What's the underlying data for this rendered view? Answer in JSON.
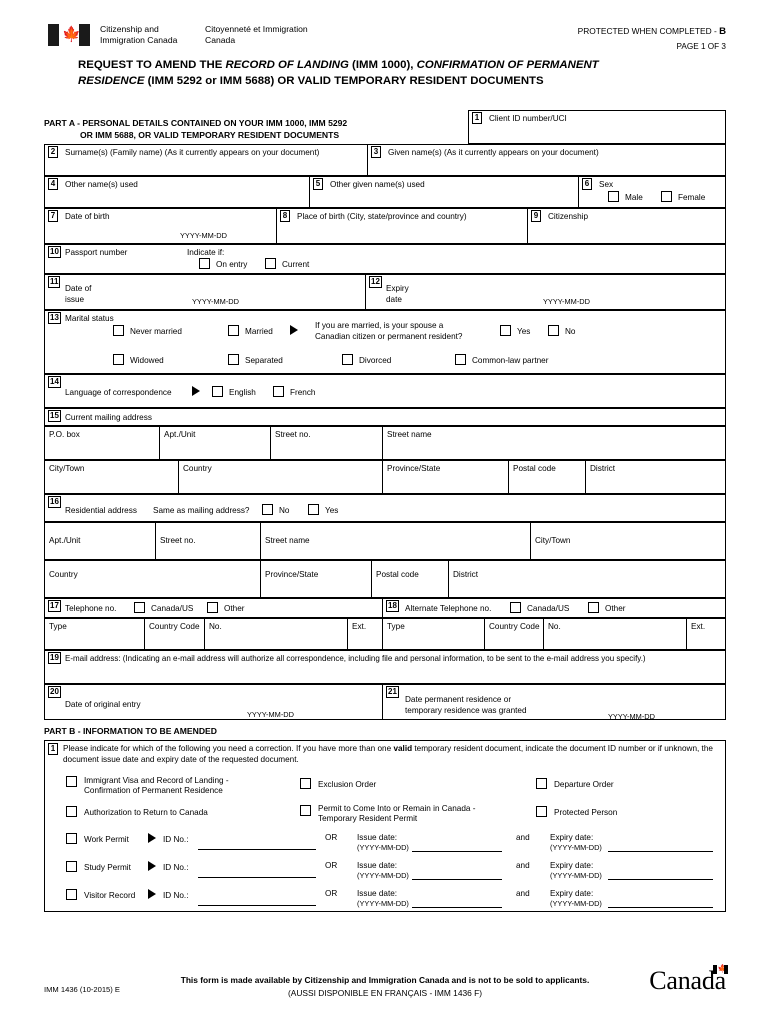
{
  "header": {
    "department_en": "Citizenship and Immigration Canada",
    "department_fr": "Citoyenneté et Immigration Canada",
    "protected": "PROTECTED WHEN COMPLETED - ",
    "protected_level": "B",
    "page_of": "PAGE 1 OF 3",
    "title_line1_a": "REQUEST TO AMEND THE ",
    "title_line1_i1": "RECORD OF LANDING",
    "title_line1_b": " (IMM 1000), ",
    "title_line1_i2": "CONFIRMATION OF PERMANENT",
    "title_line2_i": "RESIDENCE",
    "title_line2_b": " (IMM 5292 or IMM 5688) OR VALID TEMPORARY RESIDENT DOCUMENTS"
  },
  "part_a": {
    "heading_line1": "PART A - PERSONAL DETAILS CONTAINED ON YOUR IMM 1000, IMM 5292",
    "heading_line2": "OR IMM 5688, OR VALID TEMPORARY RESIDENT DOCUMENTS",
    "f1": {
      "num": "1",
      "label": "Client ID number/UCI"
    },
    "f2": {
      "num": "2",
      "label": "Surname(s) (Family name) (As it currently appears on your document)"
    },
    "f3": {
      "num": "3",
      "label": "Given name(s) (As it currently appears on your document)"
    },
    "f4": {
      "num": "4",
      "label": "Other name(s) used"
    },
    "f5": {
      "num": "5",
      "label": "Other given name(s) used"
    },
    "f6": {
      "num": "6",
      "label": "Sex",
      "male": "Male",
      "female": "Female"
    },
    "f7": {
      "num": "7",
      "label": "Date of birth",
      "hint": "YYYY-MM-DD"
    },
    "f8": {
      "num": "8",
      "label": "Place of birth (City, state/province and country)"
    },
    "f9": {
      "num": "9",
      "label": "Citizenship"
    },
    "f10": {
      "num": "10",
      "label": "Passport number",
      "indicate": "Indicate if:",
      "on_entry": "On entry",
      "current": "Current"
    },
    "f11": {
      "num": "11",
      "label_l1": "Date of",
      "label_l2": "issue",
      "hint": "YYYY-MM-DD"
    },
    "f12": {
      "num": "12",
      "label_l1": "Expiry",
      "label_l2": "date",
      "hint": "YYYY-MM-DD"
    },
    "f13": {
      "num": "13",
      "label": "Marital status",
      "options_row1": [
        "Never married",
        "Married"
      ],
      "spouse_q_l1": "If you are married, is your spouse a",
      "spouse_q_l2": "Canadian citizen or permanent resident?",
      "yes": "Yes",
      "no": "No",
      "options_row2": [
        "Widowed",
        "Separated",
        "Divorced",
        "Common-law partner"
      ]
    },
    "f14": {
      "num": "14",
      "label": "Language of correspondence",
      "english": "English",
      "french": "French"
    },
    "f15": {
      "num": "15",
      "label": "Current mailing address",
      "row1": [
        "P.O. box",
        "Apt./Unit",
        "Street no.",
        "Street name"
      ],
      "row2": [
        "City/Town",
        "Country",
        "Province/State",
        "Postal code",
        "District"
      ]
    },
    "f16": {
      "num": "16",
      "label": "Residential address",
      "same_q": "Same as mailing address?",
      "no": "No",
      "yes": "Yes",
      "row1": [
        "Apt./Unit",
        "Street no.",
        "Street name",
        "City/Town"
      ],
      "row2": [
        "Country",
        "Province/State",
        "Postal code",
        "District"
      ]
    },
    "f17": {
      "num": "17",
      "label": "Telephone no.",
      "canada_us": "Canada/US",
      "other": "Other",
      "cols": [
        "Type",
        "Country Code",
        "No.",
        "Ext."
      ]
    },
    "f18": {
      "num": "18",
      "label": "Alternate Telephone no.",
      "canada_us": "Canada/US",
      "other": "Other",
      "cols": [
        "Type",
        "Country Code",
        "No.",
        "Ext."
      ]
    },
    "f19": {
      "num": "19",
      "label": "E-mail address: (Indicating an e-mail address will authorize all correspondence, including file and personal information, to be sent to the e-mail address you specify.)"
    },
    "f20": {
      "num": "20",
      "label": "Date of original entry",
      "hint": "YYYY-MM-DD"
    },
    "f21": {
      "num": "21",
      "label_l1": "Date permanent residence or",
      "label_l2": "temporary residence was granted",
      "hint": "YYYY-MM-DD"
    }
  },
  "part_b": {
    "heading": "PART B - INFORMATION TO BE AMENDED",
    "item_num": "1",
    "instruction_a": "Please indicate for which of the following you need a correction. If you have more than one ",
    "instruction_bold": "valid",
    "instruction_b": " temporary resident document, indicate the document ID number or if",
    "instruction_l2": "unknown, the document issue date and expiry date of the requested document.",
    "checkboxes": [
      {
        "label_l1": "Immigrant Visa and Record of Landing -",
        "label_l2": "Confirmation of Permanent Residence"
      },
      {
        "label_l1": "Exclusion Order",
        "label_l2": ""
      },
      {
        "label_l1": "Departure Order",
        "label_l2": ""
      },
      {
        "label_l1": "Authorization to Return to Canada",
        "label_l2": ""
      },
      {
        "label_l1": "Permit to Come Into or Remain in Canada -",
        "label_l2": "Temporary Resident Permit"
      },
      {
        "label_l1": "Protected Person",
        "label_l2": ""
      }
    ],
    "permit_rows": [
      {
        "label": "Work Permit"
      },
      {
        "label": "Study Permit"
      },
      {
        "label": "Visitor Record"
      }
    ],
    "id_no": "ID No.:",
    "or": "OR",
    "and": "and",
    "issue_date": "Issue date:",
    "expiry_date": "Expiry date:",
    "date_format": "(YYYY-MM-DD)"
  },
  "footer": {
    "form_code": "IMM 1436 (10-2015) E",
    "notice": "This form is made available by Citizenship and Immigration Canada and is not to be sold to applicants.",
    "notice_fr": "(AUSSI DISPONIBLE EN FRANÇAIS - IMM 1436 F)",
    "wordmark": "Canada"
  }
}
